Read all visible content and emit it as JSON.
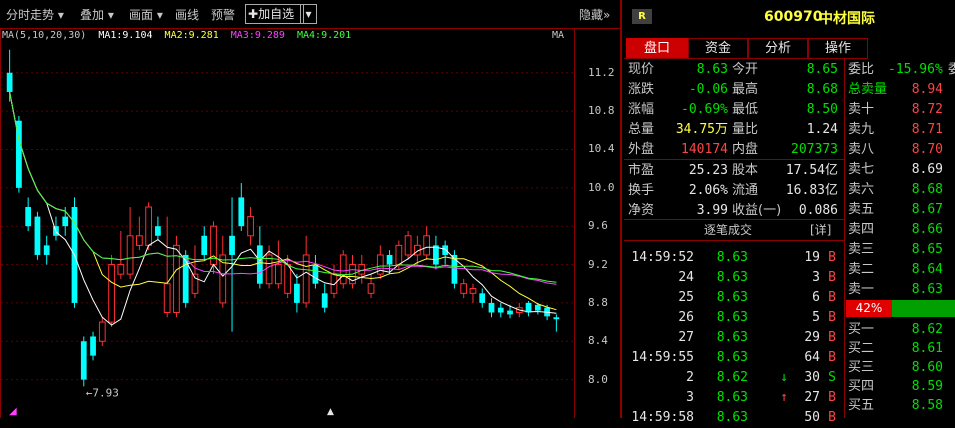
{
  "toolbar": {
    "minute_chart": "分时走势",
    "overlay": "叠加",
    "drawing": "画面",
    "draw_line": "画线",
    "alert": "预警",
    "add_watchlist": "加自选",
    "hide": "隐藏"
  },
  "ma_legend": {
    "params": "MA(5,10,20,30)",
    "ma1": "MA1:9.104",
    "ma2": "MA2:9.281",
    "ma3": "MA3:9.289",
    "ma4": "MA4:9.201",
    "corner": "MA"
  },
  "axis": {
    "price_labels": [
      "11.2",
      "10.8",
      "10.4",
      "10.0",
      "9.6",
      "9.2",
      "8.8",
      "8.4",
      "8.0"
    ],
    "high_marker": "11.44",
    "low_marker": "7.93"
  },
  "chart_data": {
    "type": "candlestick",
    "ylim": [
      7.85,
      11.5
    ],
    "candles": [
      {
        "o": 11.2,
        "c": 11.0,
        "h": 11.44,
        "l": 10.9,
        "up": false
      },
      {
        "o": 10.7,
        "c": 10.0,
        "h": 10.75,
        "l": 9.95,
        "up": false
      },
      {
        "o": 9.8,
        "c": 9.6,
        "h": 9.9,
        "l": 9.55,
        "up": false
      },
      {
        "o": 9.7,
        "c": 9.3,
        "h": 9.75,
        "l": 9.25,
        "up": false
      },
      {
        "o": 9.4,
        "c": 9.3,
        "h": 9.5,
        "l": 9.2,
        "up": false
      },
      {
        "o": 9.6,
        "c": 9.5,
        "h": 9.7,
        "l": 9.45,
        "up": false
      },
      {
        "o": 9.7,
        "c": 9.6,
        "h": 9.8,
        "l": 9.5,
        "up": false
      },
      {
        "o": 9.8,
        "c": 8.8,
        "h": 9.9,
        "l": 8.75,
        "up": false
      },
      {
        "o": 8.4,
        "c": 8.0,
        "h": 8.45,
        "l": 7.93,
        "up": false
      },
      {
        "o": 8.45,
        "c": 8.25,
        "h": 8.5,
        "l": 8.2,
        "up": false
      },
      {
        "o": 8.4,
        "c": 8.6,
        "h": 8.65,
        "l": 8.35,
        "up": true
      },
      {
        "o": 8.6,
        "c": 9.2,
        "h": 9.3,
        "l": 8.55,
        "up": true
      },
      {
        "o": 9.2,
        "c": 9.1,
        "h": 9.55,
        "l": 9.05,
        "up": true
      },
      {
        "o": 9.1,
        "c": 9.5,
        "h": 9.8,
        "l": 9.05,
        "up": true
      },
      {
        "o": 9.5,
        "c": 9.4,
        "h": 9.7,
        "l": 9.35,
        "up": true
      },
      {
        "o": 9.4,
        "c": 9.8,
        "h": 9.85,
        "l": 9.35,
        "up": true
      },
      {
        "o": 9.6,
        "c": 9.5,
        "h": 9.7,
        "l": 9.45,
        "up": false
      },
      {
        "o": 9.0,
        "c": 8.7,
        "h": 9.7,
        "l": 8.65,
        "up": true
      },
      {
        "o": 8.7,
        "c": 9.4,
        "h": 9.5,
        "l": 8.65,
        "up": true
      },
      {
        "o": 9.3,
        "c": 8.8,
        "h": 9.35,
        "l": 8.75,
        "up": false
      },
      {
        "o": 9.1,
        "c": 8.9,
        "h": 9.4,
        "l": 8.85,
        "up": true
      },
      {
        "o": 9.5,
        "c": 9.3,
        "h": 9.6,
        "l": 9.25,
        "up": false
      },
      {
        "o": 9.2,
        "c": 9.6,
        "h": 9.65,
        "l": 9.1,
        "up": true
      },
      {
        "o": 9.3,
        "c": 8.8,
        "h": 9.5,
        "l": 8.75,
        "up": true
      },
      {
        "o": 9.5,
        "c": 9.3,
        "h": 9.9,
        "l": 8.5,
        "up": false
      },
      {
        "o": 9.9,
        "c": 9.6,
        "h": 10.05,
        "l": 9.55,
        "up": false
      },
      {
        "o": 9.7,
        "c": 9.5,
        "h": 9.8,
        "l": 9.4,
        "up": true
      },
      {
        "o": 9.4,
        "c": 9.0,
        "h": 9.6,
        "l": 8.95,
        "up": false
      },
      {
        "o": 9.0,
        "c": 9.3,
        "h": 9.4,
        "l": 8.95,
        "up": true
      },
      {
        "o": 9.2,
        "c": 9.0,
        "h": 9.45,
        "l": 8.95,
        "up": true
      },
      {
        "o": 8.9,
        "c": 9.2,
        "h": 9.3,
        "l": 8.85,
        "up": true
      },
      {
        "o": 9.0,
        "c": 8.8,
        "h": 9.1,
        "l": 8.7,
        "up": false
      },
      {
        "o": 8.8,
        "c": 9.3,
        "h": 9.5,
        "l": 8.75,
        "up": true
      },
      {
        "o": 9.2,
        "c": 9.0,
        "h": 9.3,
        "l": 8.95,
        "up": false
      },
      {
        "o": 8.9,
        "c": 8.75,
        "h": 9.0,
        "l": 8.7,
        "up": false
      },
      {
        "o": 8.9,
        "c": 9.1,
        "h": 9.2,
        "l": 8.85,
        "up": true
      },
      {
        "o": 9.0,
        "c": 9.3,
        "h": 9.35,
        "l": 8.95,
        "up": true
      },
      {
        "o": 9.2,
        "c": 9.0,
        "h": 9.3,
        "l": 8.95,
        "up": true
      },
      {
        "o": 9.1,
        "c": 9.2,
        "h": 9.3,
        "l": 9.0,
        "up": true
      },
      {
        "o": 9.0,
        "c": 8.9,
        "h": 9.1,
        "l": 8.85,
        "up": true
      },
      {
        "o": 9.1,
        "c": 9.3,
        "h": 9.4,
        "l": 9.05,
        "up": true
      },
      {
        "o": 9.3,
        "c": 9.2,
        "h": 9.35,
        "l": 9.1,
        "up": false
      },
      {
        "o": 9.2,
        "c": 9.4,
        "h": 9.45,
        "l": 9.15,
        "up": true
      },
      {
        "o": 9.3,
        "c": 9.5,
        "h": 9.55,
        "l": 9.25,
        "up": true
      },
      {
        "o": 9.4,
        "c": 9.3,
        "h": 9.5,
        "l": 9.2,
        "up": true
      },
      {
        "o": 9.3,
        "c": 9.5,
        "h": 9.6,
        "l": 9.25,
        "up": true
      },
      {
        "o": 9.4,
        "c": 9.2,
        "h": 9.5,
        "l": 9.15,
        "up": false
      },
      {
        "o": 9.4,
        "c": 9.3,
        "h": 9.45,
        "l": 9.2,
        "up": false
      },
      {
        "o": 9.3,
        "c": 9.0,
        "h": 9.35,
        "l": 8.95,
        "up": false
      },
      {
        "o": 9.0,
        "c": 8.9,
        "h": 9.05,
        "l": 8.85,
        "up": true
      },
      {
        "o": 8.9,
        "c": 8.95,
        "h": 9.0,
        "l": 8.8,
        "up": true
      },
      {
        "o": 8.9,
        "c": 8.8,
        "h": 8.95,
        "l": 8.75,
        "up": false
      },
      {
        "o": 8.8,
        "c": 8.7,
        "h": 8.85,
        "l": 8.65,
        "up": false
      },
      {
        "o": 8.75,
        "c": 8.7,
        "h": 8.8,
        "l": 8.65,
        "up": false
      },
      {
        "o": 8.72,
        "c": 8.68,
        "h": 8.78,
        "l": 8.64,
        "up": false
      },
      {
        "o": 8.7,
        "c": 8.75,
        "h": 8.8,
        "l": 8.65,
        "up": true
      },
      {
        "o": 8.8,
        "c": 8.7,
        "h": 8.82,
        "l": 8.66,
        "up": false
      },
      {
        "o": 8.78,
        "c": 8.72,
        "h": 8.8,
        "l": 8.68,
        "up": false
      },
      {
        "o": 8.75,
        "c": 8.66,
        "h": 8.78,
        "l": 8.62,
        "up": false
      },
      {
        "o": 8.65,
        "c": 8.63,
        "h": 8.68,
        "l": 8.5,
        "up": false
      }
    ],
    "ma_colors": {
      "ma1": "#ffffff",
      "ma2": "#ffff40",
      "ma3": "#ff40ff",
      "ma4": "#40ff40"
    }
  },
  "header": {
    "badge": "R",
    "code": "600970",
    "name": "中材国际"
  },
  "tabs": [
    "盘口",
    "资金",
    "分析",
    "操作"
  ],
  "quote": [
    {
      "l1": "现价",
      "v1": "8.63",
      "c1": "green",
      "l2": "今开",
      "v2": "8.65",
      "c2": "green"
    },
    {
      "l1": "涨跌",
      "v1": "-0.06",
      "c1": "green",
      "l2": "最高",
      "v2": "8.68",
      "c2": "green"
    },
    {
      "l1": "涨幅",
      "v1": "-0.69%",
      "c1": "green",
      "l2": "最低",
      "v2": "8.50",
      "c2": "green"
    },
    {
      "l1": "总量",
      "v1": "34.75万",
      "c1": "yellow",
      "l2": "量比",
      "v2": "1.24",
      "c2": "white"
    },
    {
      "l1": "外盘",
      "v1": "140174",
      "c1": "red",
      "l2": "内盘",
      "v2": "207373",
      "c2": "green"
    },
    {
      "l1": "市盈",
      "v1": "25.23",
      "c1": "white",
      "l2": "股本",
      "v2": "17.54亿",
      "c2": "white"
    },
    {
      "l1": "换手",
      "v1": "2.06%",
      "c1": "white",
      "l2": "流通",
      "v2": "16.83亿",
      "c2": "white"
    },
    {
      "l1": "净资",
      "v1": "3.99",
      "c1": "white",
      "l2": "收益(一)",
      "v2": "0.086",
      "c2": "white"
    }
  ],
  "ticks": {
    "title": "逐笔成交",
    "detail": "[详]",
    "rows": [
      {
        "t": "14:59:52",
        "p": "8.63",
        "pc": "green",
        "v": "19",
        "vc": "white",
        "d": "B",
        "dc": "red",
        "arrow": ""
      },
      {
        "t": "24",
        "p": "8.63",
        "pc": "green",
        "v": "3",
        "vc": "white",
        "d": "B",
        "dc": "red",
        "arrow": ""
      },
      {
        "t": "25",
        "p": "8.63",
        "pc": "green",
        "v": "6",
        "vc": "white",
        "d": "B",
        "dc": "red",
        "arrow": ""
      },
      {
        "t": "26",
        "p": "8.63",
        "pc": "green",
        "v": "5",
        "vc": "white",
        "d": "B",
        "dc": "red",
        "arrow": ""
      },
      {
        "t": "27",
        "p": "8.63",
        "pc": "green",
        "v": "29",
        "vc": "white",
        "d": "B",
        "dc": "red",
        "arrow": ""
      },
      {
        "t": "14:59:55",
        "p": "8.63",
        "pc": "green",
        "v": "64",
        "vc": "white",
        "d": "B",
        "dc": "red",
        "arrow": ""
      },
      {
        "t": "2",
        "p": "8.62",
        "pc": "green",
        "v": "30",
        "vc": "white",
        "d": "S",
        "dc": "green",
        "arrow": "↓"
      },
      {
        "t": "3",
        "p": "8.63",
        "pc": "green",
        "v": "27",
        "vc": "white",
        "d": "B",
        "dc": "red",
        "arrow": "↑"
      },
      {
        "t": "14:59:58",
        "p": "8.63",
        "pc": "green",
        "v": "50",
        "vc": "white",
        "d": "B",
        "dc": "red",
        "arrow": ""
      }
    ]
  },
  "book": {
    "weibi_label": "委比",
    "weibi_value": "-15.96%",
    "weibi_suffix": "委",
    "total_sell_label": "总卖量",
    "total_sell_value": "8.94",
    "sells": [
      {
        "l": "卖十",
        "v": "8.72",
        "c": "red"
      },
      {
        "l": "卖九",
        "v": "8.71",
        "c": "red"
      },
      {
        "l": "卖八",
        "v": "8.70",
        "c": "red"
      },
      {
        "l": "卖七",
        "v": "8.69",
        "c": "white"
      },
      {
        "l": "卖六",
        "v": "8.68",
        "c": "green"
      },
      {
        "l": "卖五",
        "v": "8.67",
        "c": "green"
      },
      {
        "l": "卖四",
        "v": "8.66",
        "c": "green"
      },
      {
        "l": "卖三",
        "v": "8.65",
        "c": "green"
      },
      {
        "l": "卖二",
        "v": "8.64",
        "c": "green"
      },
      {
        "l": "卖一",
        "v": "8.63",
        "c": "green"
      }
    ],
    "ratio": "42%",
    "ratio_fraction": 0.42,
    "buys": [
      {
        "l": "买一",
        "v": "8.62",
        "c": "green"
      },
      {
        "l": "买二",
        "v": "8.61",
        "c": "green"
      },
      {
        "l": "买三",
        "v": "8.60",
        "c": "green"
      },
      {
        "l": "买四",
        "v": "8.59",
        "c": "green"
      },
      {
        "l": "买五",
        "v": "8.58",
        "c": "green"
      }
    ]
  }
}
